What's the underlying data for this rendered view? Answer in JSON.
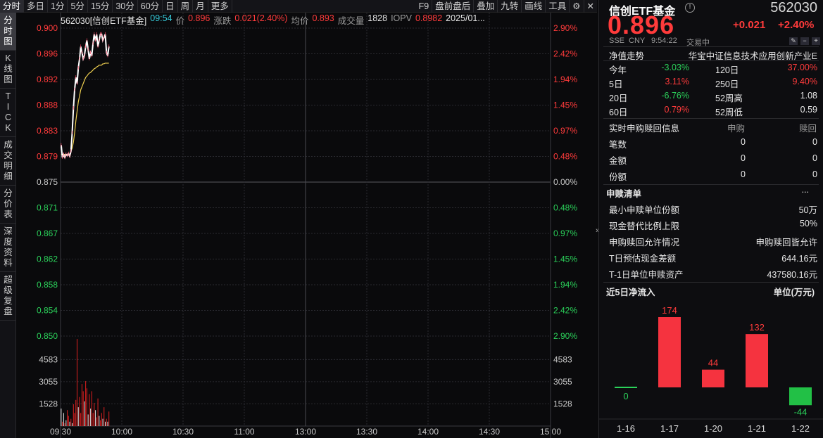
{
  "toolbar": {
    "left": [
      "分时",
      "多日",
      "1分",
      "5分",
      "15分",
      "30分",
      "60分",
      "日",
      "周",
      "月",
      "更多"
    ],
    "active": "分时",
    "right": [
      "F9",
      "盘前盘后",
      "叠加",
      "九转",
      "画线",
      "工具"
    ]
  },
  "sidebar": {
    "tabs": [
      {
        "id": "fenshi",
        "label": "分时图",
        "chars": [
          "分",
          "时",
          "图"
        ]
      },
      {
        "id": "kline",
        "label": "K线图",
        "chars": [
          "K",
          "线",
          "图"
        ]
      },
      {
        "id": "tick",
        "label": "TICK",
        "chars": [
          "T",
          "I",
          "C",
          "K"
        ]
      },
      {
        "id": "trades",
        "label": "成交明细",
        "chars": [
          "成",
          "交",
          "明",
          "细"
        ]
      },
      {
        "id": "price",
        "label": "分价表",
        "chars": [
          "分",
          "价",
          "表"
        ]
      },
      {
        "id": "depth",
        "label": "深度资料",
        "chars": [
          "深",
          "度",
          "资",
          "料"
        ]
      },
      {
        "id": "replay",
        "label": "超级复盘",
        "chars": [
          "超",
          "级",
          "复",
          "盘"
        ]
      }
    ],
    "active": "fenshi"
  },
  "infoline": {
    "code_name": "562030[信创ETF基金]",
    "time": "09:54",
    "price_label": "价",
    "price": "0.896",
    "change_label": "涨跌",
    "change": "0.021(2.40%)",
    "avg_label": "均价",
    "avg": "0.893",
    "vol_label": "成交量",
    "vol": "1828",
    "iopv_label": "IOPV",
    "iopv": "0.8982",
    "date": "2025/01..."
  },
  "chart_data": {
    "type": "line",
    "title": "",
    "prev_close": 0.875,
    "price_ticks": [
      "0.900",
      "0.896",
      "0.892",
      "0.888",
      "0.883",
      "0.879",
      "0.875",
      "0.871",
      "0.867",
      "0.862",
      "0.858",
      "0.854",
      "0.850"
    ],
    "pct_ticks": [
      "2.90%",
      "2.42%",
      "1.94%",
      "1.45%",
      "0.97%",
      "0.48%",
      "0.00%",
      "0.48%",
      "0.97%",
      "1.45%",
      "1.94%",
      "2.42%",
      "2.90%"
    ],
    "vol_ticks": [
      "4583",
      "3055",
      "1528"
    ],
    "time_ticks": [
      "09:30",
      "10:00",
      "10:30",
      "11:00",
      "13:00",
      "13:30",
      "14:00",
      "14:30",
      "15:00"
    ],
    "ylim": [
      0.85,
      0.9
    ],
    "price_series": [
      0.881,
      0.879,
      0.8795,
      0.879,
      0.8795,
      0.8793,
      0.8796,
      0.8792,
      0.88,
      0.883,
      0.887,
      0.89,
      0.892,
      0.891,
      0.8935,
      0.895,
      0.897,
      0.896,
      0.895,
      0.8955,
      0.897,
      0.898,
      0.8965,
      0.895,
      0.896,
      0.8955,
      0.8975,
      0.899,
      0.898,
      0.899,
      0.897,
      0.898,
      0.899,
      0.899,
      0.898,
      0.8985,
      0.899,
      0.896,
      0.8955,
      0.897
    ],
    "avg_series": [
      0.8795,
      0.8795,
      0.8795,
      0.8795,
      0.8795,
      0.8795,
      0.8795,
      0.8795,
      0.88,
      0.8805,
      0.8815,
      0.883,
      0.885,
      0.8865,
      0.888,
      0.889,
      0.89,
      0.8905,
      0.891,
      0.8915,
      0.892,
      0.8922,
      0.8925,
      0.8927,
      0.8928,
      0.893,
      0.8932,
      0.8934,
      0.8935,
      0.8937,
      0.8938,
      0.894,
      0.894,
      0.894,
      0.8942,
      0.8942,
      0.8943,
      0.8943,
      0.8943,
      0.8943
    ],
    "volumes": [
      1200,
      300,
      900,
      200,
      400,
      1100,
      700,
      300,
      500,
      200,
      1500,
      900,
      1800,
      6000,
      1300,
      2000,
      900,
      2900,
      2400,
      1700,
      3100,
      2600,
      800,
      2200,
      1200,
      2400,
      900,
      1600,
      1100,
      600,
      1900,
      700,
      400,
      900,
      500,
      1300,
      300,
      500,
      300,
      1000
    ],
    "volume_up": [
      false,
      true,
      false,
      true,
      false,
      true,
      true,
      false,
      true,
      false,
      true,
      true,
      true,
      true,
      false,
      true,
      true,
      true,
      true,
      false,
      true,
      true,
      false,
      true,
      false,
      true,
      true,
      true,
      false,
      true,
      true,
      false,
      true,
      true,
      false,
      true,
      false,
      true,
      false,
      true
    ]
  },
  "quote": {
    "name": "信创ETF基金",
    "code": "562030",
    "price": "0.896",
    "change": "+0.021",
    "pct": "+2.40%",
    "exchange": "SSE",
    "currency": "CNY",
    "time": "9:54:22",
    "status": "交易中"
  },
  "nav": {
    "label": "净值走势",
    "index_name": "华宝中证信息技术应用创新产业E",
    "stats": [
      {
        "l1": "今年",
        "v1": "-3.03%",
        "c1": "green",
        "l2": "120日",
        "v2": "37.00%",
        "c2": "red"
      },
      {
        "l1": "5日",
        "v1": "3.11%",
        "c1": "red",
        "l2": "250日",
        "v2": "9.40%",
        "c2": "red"
      },
      {
        "l1": "20日",
        "v1": "-6.76%",
        "c1": "green",
        "l2": "52周高",
        "v2": "1.08",
        "c2": "white"
      },
      {
        "l1": "60日",
        "v1": "0.79%",
        "c1": "red",
        "l2": "52周低",
        "v2": "0.59",
        "c2": "white"
      }
    ]
  },
  "creation": {
    "title": "实时申购赎回信息",
    "col1": "申购",
    "col2": "赎回",
    "rows": [
      {
        "label": "笔数",
        "v1": "0",
        "v2": "0"
      },
      {
        "label": "金额",
        "v1": "0",
        "v2": "0"
      },
      {
        "label": "份额",
        "v1": "0",
        "v2": "0"
      }
    ]
  },
  "pcf": {
    "title": "申赎清单",
    "more": "...",
    "rows": [
      {
        "label": "最小申赎单位份额",
        "value": "50万"
      },
      {
        "label": "现金替代比例上限",
        "value": "50%"
      },
      {
        "label": "申购赎回允许情况",
        "value": "申购赎回皆允许"
      },
      {
        "label": "T日预估现金差额",
        "value": "644.16元"
      },
      {
        "label": "T-1日单位申赎资产",
        "value": "437580.16元"
      }
    ]
  },
  "netflow": {
    "title": "近5日净流入",
    "unit": "单位(万元)",
    "bars": [
      {
        "date": "1-16",
        "value": 0,
        "label": "0"
      },
      {
        "date": "1-17",
        "value": 174,
        "label": "174"
      },
      {
        "date": "1-20",
        "value": 44,
        "label": "44"
      },
      {
        "date": "1-21",
        "value": 132,
        "label": "132"
      },
      {
        "date": "1-22",
        "value": -44,
        "label": "-44"
      }
    ]
  },
  "colors": {
    "up": "#ff3b3b",
    "down": "#2bd15a",
    "price_line": "#ffffff",
    "avg_line": "#f0d050",
    "grid": "#2a2a30"
  }
}
